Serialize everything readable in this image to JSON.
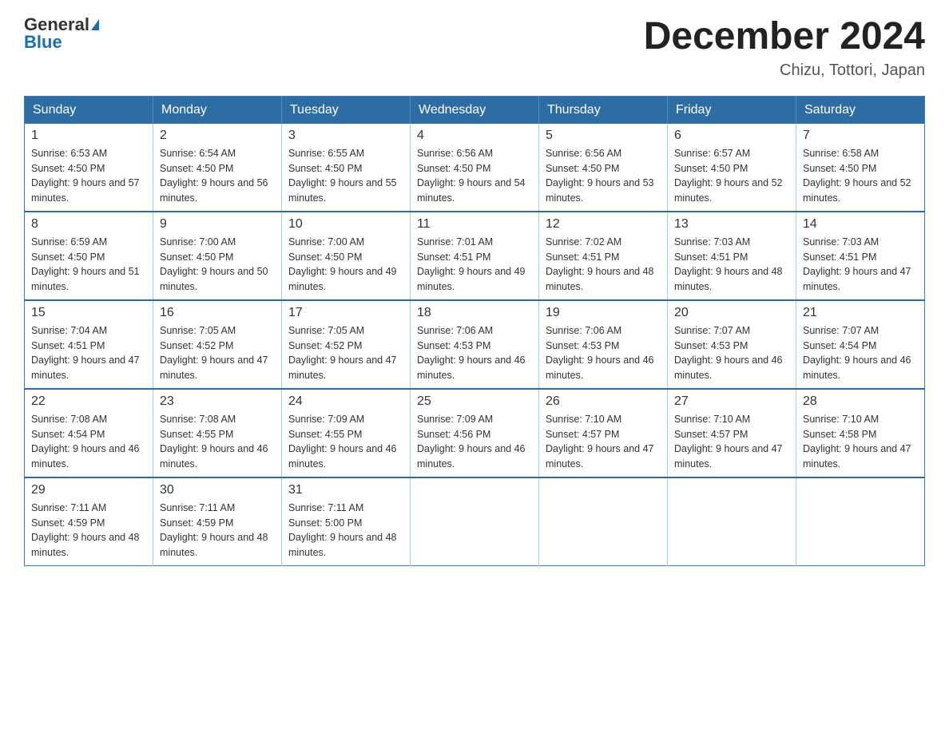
{
  "header": {
    "logo_general": "General",
    "logo_blue": "Blue",
    "month_title": "December 2024",
    "subtitle": "Chizu, Tottori, Japan"
  },
  "days_of_week": [
    "Sunday",
    "Monday",
    "Tuesday",
    "Wednesday",
    "Thursday",
    "Friday",
    "Saturday"
  ],
  "weeks": [
    [
      {
        "day": "1",
        "sunrise": "6:53 AM",
        "sunset": "4:50 PM",
        "daylight": "9 hours and 57 minutes."
      },
      {
        "day": "2",
        "sunrise": "6:54 AM",
        "sunset": "4:50 PM",
        "daylight": "9 hours and 56 minutes."
      },
      {
        "day": "3",
        "sunrise": "6:55 AM",
        "sunset": "4:50 PM",
        "daylight": "9 hours and 55 minutes."
      },
      {
        "day": "4",
        "sunrise": "6:56 AM",
        "sunset": "4:50 PM",
        "daylight": "9 hours and 54 minutes."
      },
      {
        "day": "5",
        "sunrise": "6:56 AM",
        "sunset": "4:50 PM",
        "daylight": "9 hours and 53 minutes."
      },
      {
        "day": "6",
        "sunrise": "6:57 AM",
        "sunset": "4:50 PM",
        "daylight": "9 hours and 52 minutes."
      },
      {
        "day": "7",
        "sunrise": "6:58 AM",
        "sunset": "4:50 PM",
        "daylight": "9 hours and 52 minutes."
      }
    ],
    [
      {
        "day": "8",
        "sunrise": "6:59 AM",
        "sunset": "4:50 PM",
        "daylight": "9 hours and 51 minutes."
      },
      {
        "day": "9",
        "sunrise": "7:00 AM",
        "sunset": "4:50 PM",
        "daylight": "9 hours and 50 minutes."
      },
      {
        "day": "10",
        "sunrise": "7:00 AM",
        "sunset": "4:50 PM",
        "daylight": "9 hours and 49 minutes."
      },
      {
        "day": "11",
        "sunrise": "7:01 AM",
        "sunset": "4:51 PM",
        "daylight": "9 hours and 49 minutes."
      },
      {
        "day": "12",
        "sunrise": "7:02 AM",
        "sunset": "4:51 PM",
        "daylight": "9 hours and 48 minutes."
      },
      {
        "day": "13",
        "sunrise": "7:03 AM",
        "sunset": "4:51 PM",
        "daylight": "9 hours and 48 minutes."
      },
      {
        "day": "14",
        "sunrise": "7:03 AM",
        "sunset": "4:51 PM",
        "daylight": "9 hours and 47 minutes."
      }
    ],
    [
      {
        "day": "15",
        "sunrise": "7:04 AM",
        "sunset": "4:51 PM",
        "daylight": "9 hours and 47 minutes."
      },
      {
        "day": "16",
        "sunrise": "7:05 AM",
        "sunset": "4:52 PM",
        "daylight": "9 hours and 47 minutes."
      },
      {
        "day": "17",
        "sunrise": "7:05 AM",
        "sunset": "4:52 PM",
        "daylight": "9 hours and 47 minutes."
      },
      {
        "day": "18",
        "sunrise": "7:06 AM",
        "sunset": "4:53 PM",
        "daylight": "9 hours and 46 minutes."
      },
      {
        "day": "19",
        "sunrise": "7:06 AM",
        "sunset": "4:53 PM",
        "daylight": "9 hours and 46 minutes."
      },
      {
        "day": "20",
        "sunrise": "7:07 AM",
        "sunset": "4:53 PM",
        "daylight": "9 hours and 46 minutes."
      },
      {
        "day": "21",
        "sunrise": "7:07 AM",
        "sunset": "4:54 PM",
        "daylight": "9 hours and 46 minutes."
      }
    ],
    [
      {
        "day": "22",
        "sunrise": "7:08 AM",
        "sunset": "4:54 PM",
        "daylight": "9 hours and 46 minutes."
      },
      {
        "day": "23",
        "sunrise": "7:08 AM",
        "sunset": "4:55 PM",
        "daylight": "9 hours and 46 minutes."
      },
      {
        "day": "24",
        "sunrise": "7:09 AM",
        "sunset": "4:55 PM",
        "daylight": "9 hours and 46 minutes."
      },
      {
        "day": "25",
        "sunrise": "7:09 AM",
        "sunset": "4:56 PM",
        "daylight": "9 hours and 46 minutes."
      },
      {
        "day": "26",
        "sunrise": "7:10 AM",
        "sunset": "4:57 PM",
        "daylight": "9 hours and 47 minutes."
      },
      {
        "day": "27",
        "sunrise": "7:10 AM",
        "sunset": "4:57 PM",
        "daylight": "9 hours and 47 minutes."
      },
      {
        "day": "28",
        "sunrise": "7:10 AM",
        "sunset": "4:58 PM",
        "daylight": "9 hours and 47 minutes."
      }
    ],
    [
      {
        "day": "29",
        "sunrise": "7:11 AM",
        "sunset": "4:59 PM",
        "daylight": "9 hours and 48 minutes."
      },
      {
        "day": "30",
        "sunrise": "7:11 AM",
        "sunset": "4:59 PM",
        "daylight": "9 hours and 48 minutes."
      },
      {
        "day": "31",
        "sunrise": "7:11 AM",
        "sunset": "5:00 PM",
        "daylight": "9 hours and 48 minutes."
      },
      null,
      null,
      null,
      null
    ]
  ]
}
